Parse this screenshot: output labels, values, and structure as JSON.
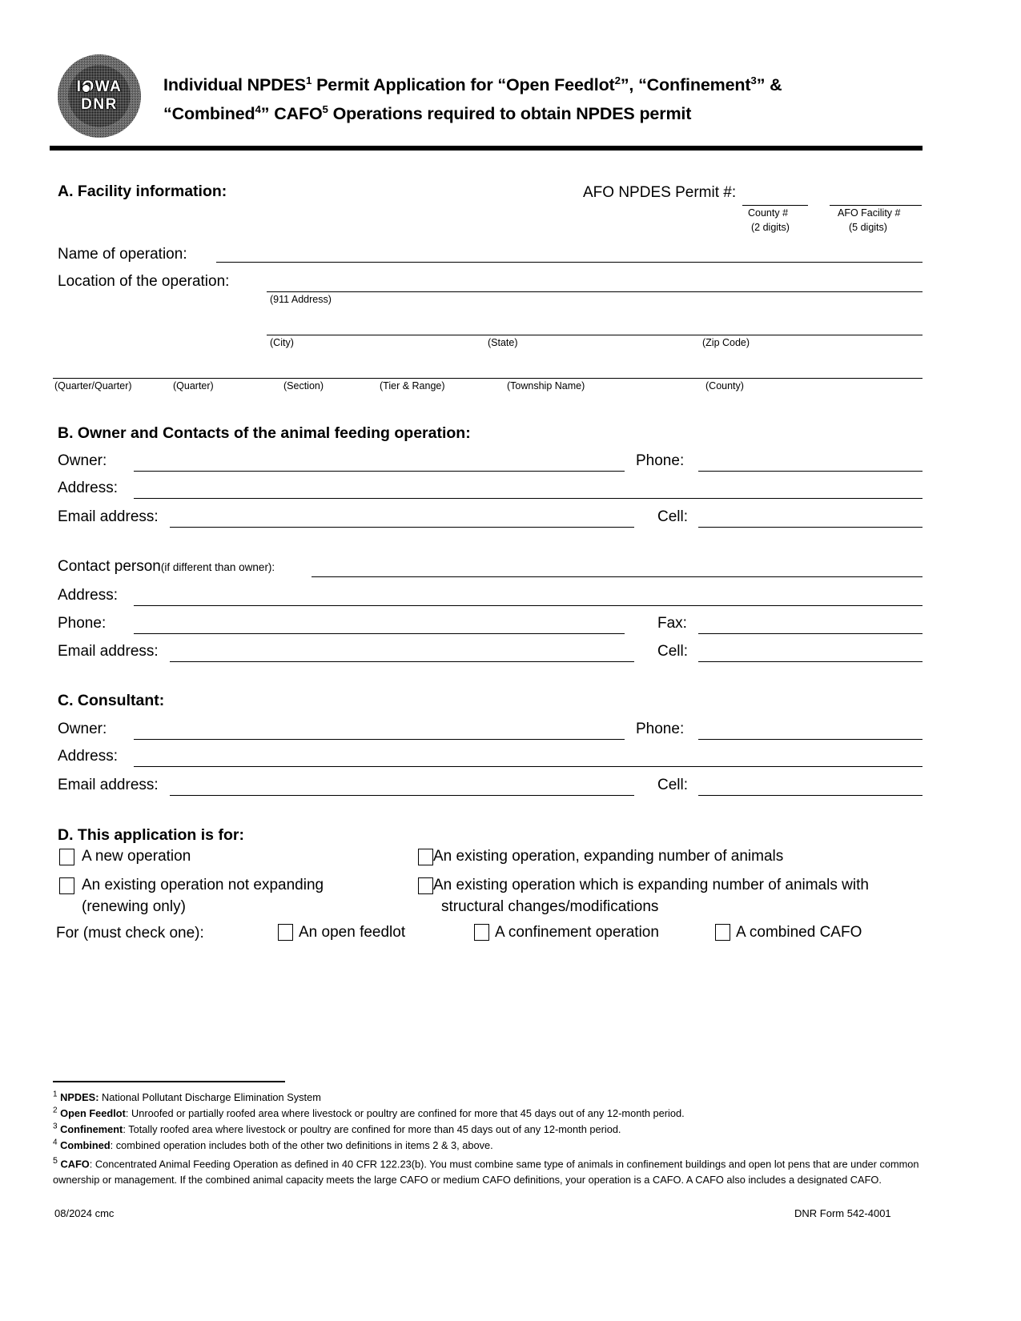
{
  "document": {
    "logo": {
      "line1": "IOWA",
      "line2": "DNR",
      "alt": "Iowa DNR seal"
    },
    "title_line1": "Individual NPDES¹ Permit Application for “Open Feedlot²”, “Confinement³” &",
    "title_line2": "“Combined⁴” CAFO⁵ Operations required to obtain NPDES permit",
    "title_parts": {
      "l1_a": "Individual NPDES",
      "l1_s1": "1",
      "l1_b": " Permit Application for “Open Feedlot",
      "l1_s2": "2",
      "l1_c": "”, “Confinement",
      "l1_s3": "3",
      "l1_d": "” &",
      "l2_a": "“Combined",
      "l2_s4": "4",
      "l2_b": "” CAFO",
      "l2_s5": "5",
      "l2_c": " Operations required to obtain NPDES permit"
    }
  },
  "section_a": {
    "heading": "A. Facility information:",
    "permit_label": "AFO NPDES Permit #:",
    "county_caption_1": "County #",
    "county_caption_2": "(2 digits)",
    "facility_caption_1": "AFO Facility #",
    "facility_caption_2": "(5 digits)",
    "name_label": "Name of operation:",
    "location_label": "Location of the operation:",
    "address_caption": "(911 Address)",
    "city_caption": "(City)",
    "state_caption": "(State)",
    "zip_caption": "(Zip Code)",
    "legal_captions": [
      "(Quarter/Quarter)",
      "(Quarter)",
      "(Section)",
      "(Tier & Range)",
      "(Township Name)",
      "(County)"
    ]
  },
  "section_b": {
    "heading": "B. Owner and Contacts of the animal feeding operation:",
    "owner_label": "Owner:",
    "phone_label": "Phone:",
    "address_label": "Address:",
    "email_label": "Email address:",
    "cell_label": "Cell:",
    "contact_label": "Contact person",
    "contact_label_note": "(if different than owner):",
    "contact_address_label": "Address:",
    "contact_phone_label": "Phone:",
    "fax_label": "Fax:",
    "contact_email_label": "Email address:",
    "contact_cell_label": "Cell:"
  },
  "section_c": {
    "heading": "C. Consultant:",
    "owner_label": "Owner:",
    "phone_label": "Phone:",
    "address_label": "Address:",
    "email_label": "Email address:",
    "cell_label": "Cell:"
  },
  "section_d": {
    "heading": "D. This application is for:",
    "options": [
      {
        "label": "A new operation"
      },
      {
        "label": "An existing operation, expanding number of animals"
      },
      {
        "label": "An existing operation not expanding"
      },
      {
        "label": "(renewing only)"
      },
      {
        "label": "An existing operation which is expanding number of animals with"
      },
      {
        "label": "structural changes/modifications"
      }
    ],
    "for_label": "For (must check one):",
    "for_options": [
      {
        "label": "An open feedlot"
      },
      {
        "label": "A confinement operation"
      },
      {
        "label": "A combined CAFO"
      }
    ]
  },
  "footnotes": {
    "n1_sup": "1",
    "n1_bold": "NPDES:",
    "n1_text": " National Pollutant Discharge Elimination System",
    "n2_sup": "2",
    "n2_bold": "Open Feedlot",
    "n2_text": ": Unroofed or partially roofed area where livestock or poultry are confined for more that 45 days out of any 12-month period.",
    "n3_sup": "3",
    "n3_bold": "Confinement",
    "n3_text": ": Totally roofed area where livestock or poultry are confined for more than 45 days out of any 12-month period.",
    "n4_sup": "4",
    "n4_bold": "Combined",
    "n4_text": ": combined operation includes both of the other two definitions in items 2 & 3, above.",
    "n5_sup": "5",
    "n5_bold": "CAFO",
    "n5_text": ": Concentrated Animal Feeding Operation as defined in 40 CFR 122.23(b). You must combine same type of animals in confinement buildings and open lot pens that are under common ownership or management.  If the combined animal capacity meets the large CAFO or medium CAFO definitions, your operation is a CAFO. A CAFO also includes a designated CAFO."
  },
  "footer": {
    "left": "08/2024 cmc",
    "right": "DNR Form 542-4001"
  }
}
